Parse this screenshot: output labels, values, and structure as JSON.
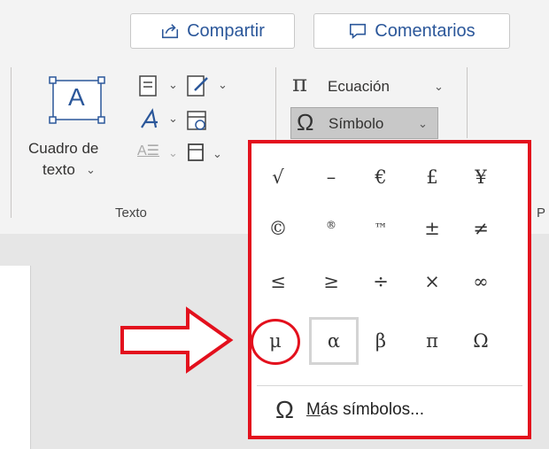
{
  "header": {
    "share_label": "Compartir",
    "comments_label": "Comentarios",
    "accent": "#2b579a"
  },
  "ribbon": {
    "textbox_line1": "Cuadro de",
    "textbox_line2": "texto",
    "textbox_icon_letter": "A",
    "equation_label": "Ecuación",
    "symbol_label": "Símbolo",
    "group_label": "Texto",
    "cut_label": "P"
  },
  "dropdown": {
    "border_color": "#e3101d",
    "symbols": [
      [
        "√",
        "–",
        "€",
        "£",
        "¥"
      ],
      [
        "©",
        "®",
        "™",
        "±",
        "≠"
      ],
      [
        "≤",
        "≥",
        "÷",
        "×",
        "∞"
      ],
      [
        "μ",
        "α",
        "β",
        "π",
        "Ω"
      ]
    ],
    "more_icon": "Ω",
    "more_label_first": "M",
    "more_label_rest": "ás símbolos..."
  },
  "icons": {
    "share": "share-icon",
    "comments": "comment-icon",
    "pointer": "arrow-right-outline-icon"
  }
}
